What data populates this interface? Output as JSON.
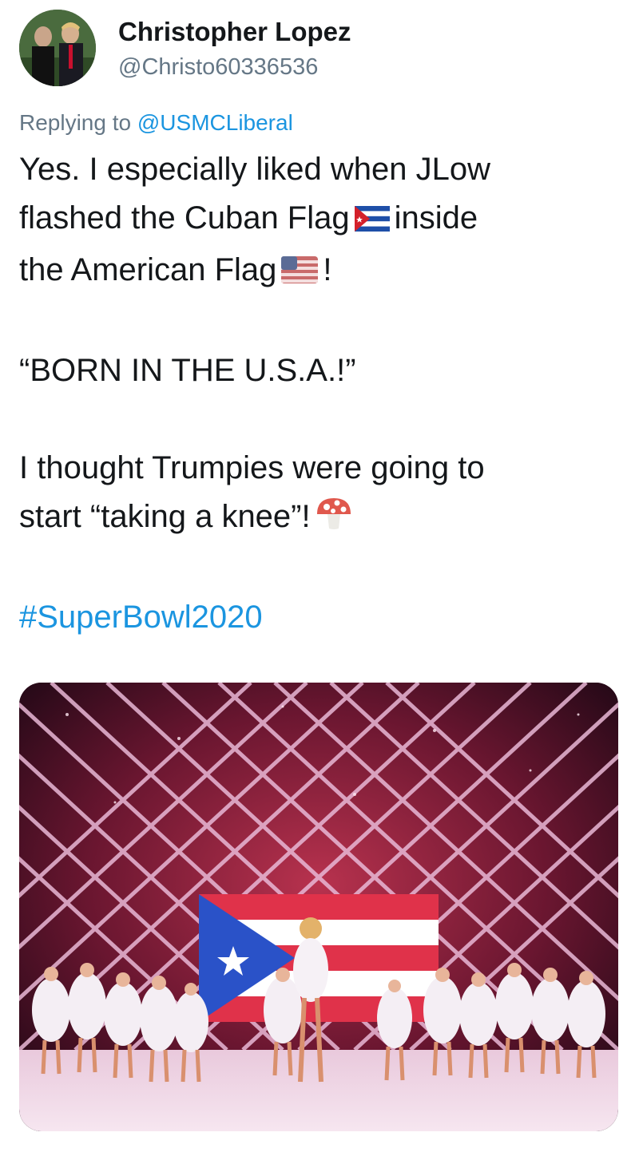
{
  "tweet": {
    "display_name": "Christopher Lopez",
    "handle": "@Christo60336536",
    "replying_prefix": "Replying to ",
    "replying_to": "@USMCLiberal",
    "line1": "Yes. I especially liked when JLow",
    "line2a": "flashed the Cuban Flag",
    "line2b": "inside",
    "line3a": "the American Flag",
    "line3b": "!",
    "para2": "“BORN IN THE U.S.A.!”",
    "para3a": "I thought Trumpies were going to",
    "para3b": "start “taking a knee”!",
    "hashtag": "#SuperBowl2020"
  },
  "icons": {
    "cuban_flag": "cuban-flag-emoji",
    "us_flag": "us-flag-emoji",
    "mushroom": "mushroom-emoji"
  },
  "colors": {
    "link": "#1b95e0",
    "secondary_text": "#657786",
    "primary_text": "#14171a"
  }
}
